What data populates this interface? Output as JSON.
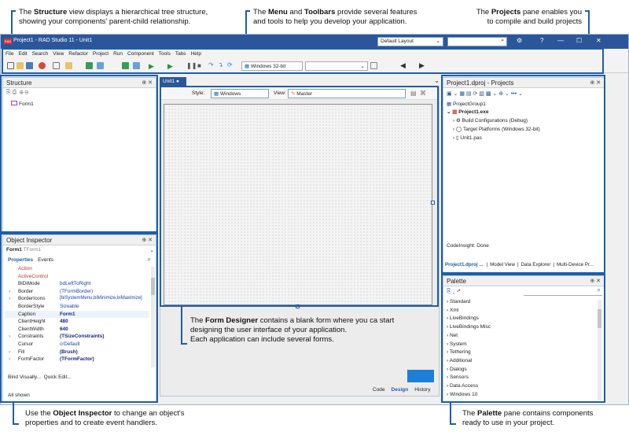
{
  "callouts": {
    "structure": {
      "pre": "The ",
      "bold": "Structure",
      "post": " view displays a hierarchical tree structure,",
      "line2": "showing your components' parent-child relationship."
    },
    "menu": {
      "pre": "The ",
      "bold1": "Menu",
      "mid": "  and ",
      "bold2": "Toolbars",
      "post": " provide several features",
      "line2": "and tools to help you develop your application."
    },
    "projects": {
      "pre": "The ",
      "bold": "Projects",
      "post": " pane enables you",
      "line2": "to compile and build projects"
    },
    "form_designer": {
      "pre": "The ",
      "bold": "Form Designer",
      "post": " contains a blank form where you ca start",
      "line2": "designing the user interface of your application.",
      "line3": "Each application can include several forms."
    },
    "object_inspector": {
      "pre": "Use the ",
      "bold": "Object Inspector",
      "post": " to change an object's",
      "line2": "properties and to create event handlers."
    },
    "palette": {
      "pre": "The ",
      "bold": "Palette",
      "post": " pane contains components",
      "line2": "ready to use in your project."
    }
  },
  "titlebar": {
    "title": "Project1 - RAD Studio 11 - Unit1",
    "logo": "RAD",
    "layout": "Default Layout",
    "search_placeholder": "",
    "help": "?",
    "min": "—",
    "max": "☐",
    "close": "✕"
  },
  "menu": [
    "File",
    "Edit",
    "Search",
    "View",
    "Refactor",
    "Project",
    "Run",
    "Component",
    "Tools",
    "Tabs",
    "Help"
  ],
  "toolbar": {
    "platform": "Windows 32-bit",
    "config": ""
  },
  "structure": {
    "title": "Structure",
    "tree_item": "Form1"
  },
  "unit_tab": {
    "label": "Unit1",
    "style_label": "Style:",
    "style_value": "Windows",
    "view_label": "View:",
    "view_value": "Master"
  },
  "object_inspector": {
    "title": "Object Inspector",
    "object": "Form1",
    "object_type": "TForm1",
    "tab_properties": "Properties",
    "tab_events": "Events",
    "rows": [
      {
        "name": "Action",
        "value": "",
        "red": true
      },
      {
        "name": "ActiveControl",
        "value": "",
        "red": true
      },
      {
        "name": "BiDiMode",
        "value": "bdLeftToRight"
      },
      {
        "name": "Border",
        "value": "(TFormBorder)",
        "caret": true
      },
      {
        "name": "BorderIcons",
        "value": "[biSystemMenu,biMinimize,biMaximize]",
        "caret": true
      },
      {
        "name": "BorderStyle",
        "value": "Sizeable"
      },
      {
        "name": "Caption",
        "value": "Form1",
        "bold": true
      },
      {
        "name": "ClientHeight",
        "value": "480",
        "bold": true
      },
      {
        "name": "ClientWidth",
        "value": "640",
        "bold": true
      },
      {
        "name": "Constraints",
        "value": "(TSizeConstraints)",
        "caret": true,
        "bold": true
      },
      {
        "name": "Cursor",
        "value": "crDefault"
      },
      {
        "name": "Fill",
        "value": "(Brush)",
        "caret": true,
        "bold": true
      },
      {
        "name": "FormFactor",
        "value": "(TFormFactor)",
        "caret": true,
        "bold": true
      }
    ],
    "bind_visually": "Bind Visually...",
    "quick_edit": "Quick Edit...",
    "status": "All shown"
  },
  "projects": {
    "title": "Project1.dproj - Projects",
    "group": "ProjectGroup1",
    "exe": "Project1.exe",
    "items": [
      "Build Configurations (Debug)",
      "Target Platforms (Windows 32-bit)",
      "Unit1.pas"
    ],
    "codeinsight": "CodeInsight: Done",
    "tabs": [
      "Project1.dproj ...",
      "Model View",
      "Data Explorer",
      "Multi-Device Pr..."
    ]
  },
  "palette": {
    "title": "Palette",
    "items": [
      "Standard",
      "Xml",
      "LiveBindings",
      "LiveBindings Misc",
      "Net",
      "System",
      "Tethering",
      "Additional",
      "Dialogs",
      "Sensors",
      "Data Access",
      "Windows 10"
    ]
  },
  "bottom_tabs": [
    "Code",
    "Design",
    "History"
  ],
  "colors": {
    "accent": "#1d5fa8",
    "titlebar": "#2b579a",
    "value_blue": "#1c3fa6",
    "event_red": "#c0392b"
  }
}
